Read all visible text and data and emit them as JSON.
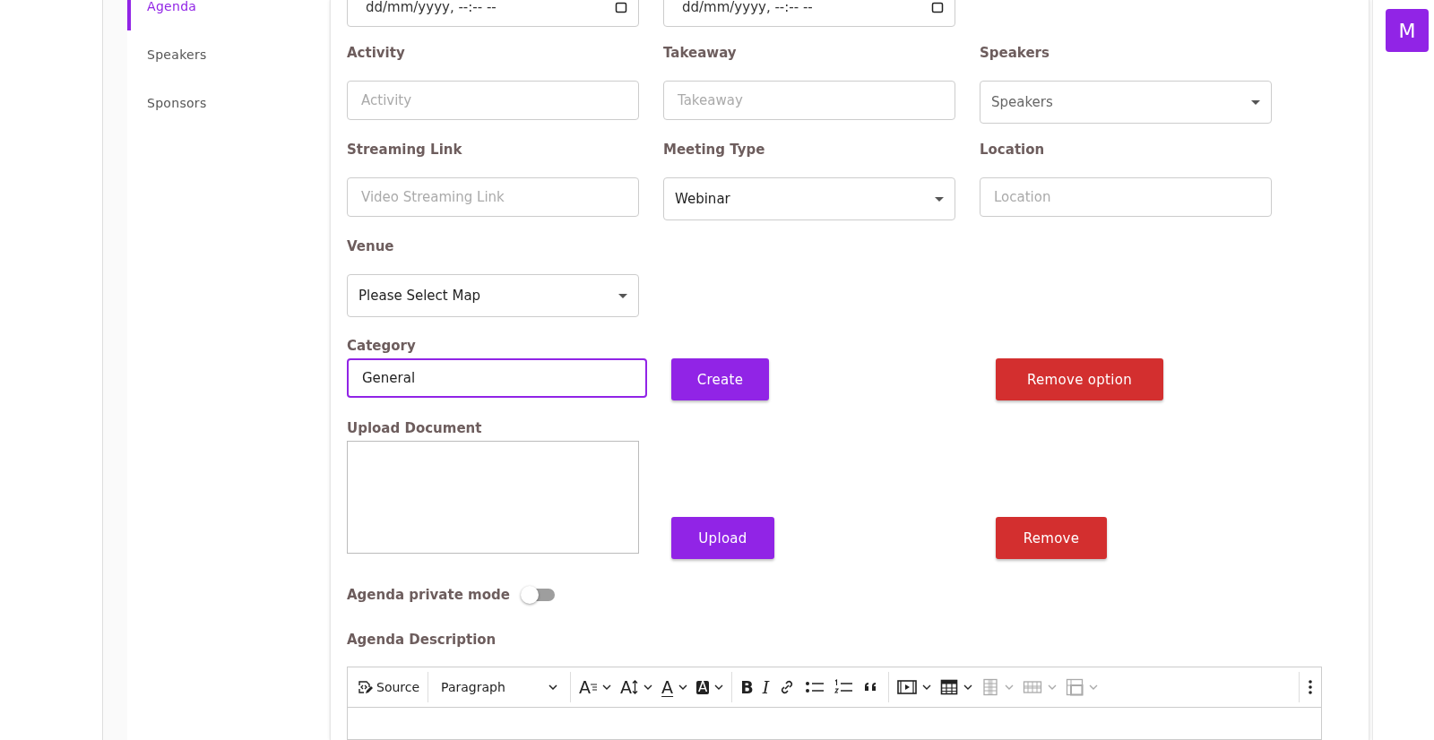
{
  "sidebar": {
    "items": [
      {
        "label": "Agenda",
        "selected": true
      },
      {
        "label": "Speakers",
        "selected": false
      },
      {
        "label": "Sponsors",
        "selected": false
      }
    ]
  },
  "avatar": {
    "initial": "M"
  },
  "date_fields": [
    {
      "placeholder": "dd/mm/yyyy, --:-- --"
    },
    {
      "placeholder": "dd/mm/yyyy, --:-- --"
    }
  ],
  "field_rows": [
    [
      {
        "label": "Activity",
        "kind": "text",
        "placeholder": "Activity"
      },
      {
        "label": "Takeaway",
        "kind": "text",
        "placeholder": "Takeaway"
      },
      {
        "label": "Speakers",
        "kind": "select",
        "placeholder": "Speakers"
      }
    ],
    [
      {
        "label": "Streaming Link",
        "kind": "text",
        "placeholder": "Video Streaming Link"
      },
      {
        "label": "Meeting Type",
        "kind": "select",
        "value": "Webinar"
      },
      {
        "label": "Location",
        "kind": "text",
        "placeholder": "Location"
      }
    ],
    [
      {
        "label": "Venue",
        "kind": "select",
        "value": "Please Select Map"
      }
    ]
  ],
  "category": {
    "label": "Category",
    "value": "General",
    "focused": true,
    "create_button": "Create",
    "remove_button": "Remove option"
  },
  "upload": {
    "label": "Upload Document",
    "upload_button": "Upload",
    "remove_button": "Remove"
  },
  "private_mode": {
    "label": "Agenda private mode",
    "on": false
  },
  "description": {
    "label": "Agenda Description",
    "toolbar": [
      {
        "kind": "source",
        "label": "Source"
      },
      {
        "kind": "separator"
      },
      {
        "kind": "heading",
        "label": "Paragraph"
      },
      {
        "kind": "separator"
      },
      {
        "kind": "font-family",
        "glyph": "A",
        "dropdown": true,
        "disabled": false
      },
      {
        "kind": "font-size",
        "glyph": "A",
        "dropdown": true,
        "disabled": false
      },
      {
        "kind": "font-color",
        "glyph": "A",
        "dropdown": true,
        "disabled": false
      },
      {
        "kind": "font-background",
        "glyph": "A",
        "dropdown": true,
        "disabled": false
      },
      {
        "kind": "separator"
      },
      {
        "kind": "bold",
        "glyph": "B",
        "dropdown": false,
        "disabled": false
      },
      {
        "kind": "italic",
        "glyph": "I",
        "dropdown": false,
        "disabled": false
      },
      {
        "kind": "link",
        "dropdown": false,
        "disabled": false
      },
      {
        "kind": "bulleted-list",
        "dropdown": false,
        "disabled": false
      },
      {
        "kind": "numbered-list",
        "dropdown": false,
        "disabled": false
      },
      {
        "kind": "quote",
        "dropdown": false,
        "disabled": false
      },
      {
        "kind": "separator"
      },
      {
        "kind": "media",
        "dropdown": true,
        "disabled": false
      },
      {
        "kind": "table",
        "dropdown": true,
        "disabled": false
      },
      {
        "kind": "table-column",
        "dropdown": true,
        "disabled": true
      },
      {
        "kind": "table-row",
        "dropdown": true,
        "disabled": true
      },
      {
        "kind": "merge-cells",
        "dropdown": true,
        "disabled": true
      },
      {
        "kind": "spacer"
      },
      {
        "kind": "separator"
      },
      {
        "kind": "more",
        "dropdown": false,
        "disabled": false
      }
    ]
  }
}
